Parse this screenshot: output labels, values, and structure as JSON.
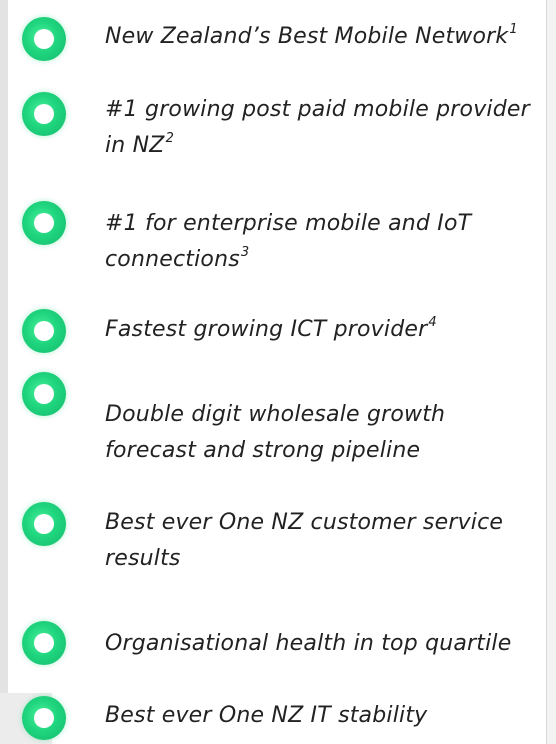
{
  "items": [
    {
      "text": "New Zealand’s Best Mobile Network",
      "sup": "1"
    },
    {
      "text": "#1 growing post paid mobile provider in NZ",
      "sup": "2"
    },
    {
      "text": "#1 for enterprise mobile and IoT connections",
      "sup": "3"
    },
    {
      "text": "Fastest growing ICT provider",
      "sup": "4"
    },
    {
      "text": "Double digit wholesale growth forecast and strong pipeline",
      "sup": ""
    },
    {
      "text": "Best ever One NZ customer service results",
      "sup": ""
    },
    {
      "text": "Organisational health in top quartile",
      "sup": ""
    },
    {
      "text": "Best ever One NZ IT stability",
      "sup": ""
    }
  ],
  "bullet_icon": "green-ring-icon",
  "colors": {
    "accent": "#1fd57e",
    "text": "#222222",
    "panel": "#ffffff",
    "background": "#f3f3f3"
  }
}
